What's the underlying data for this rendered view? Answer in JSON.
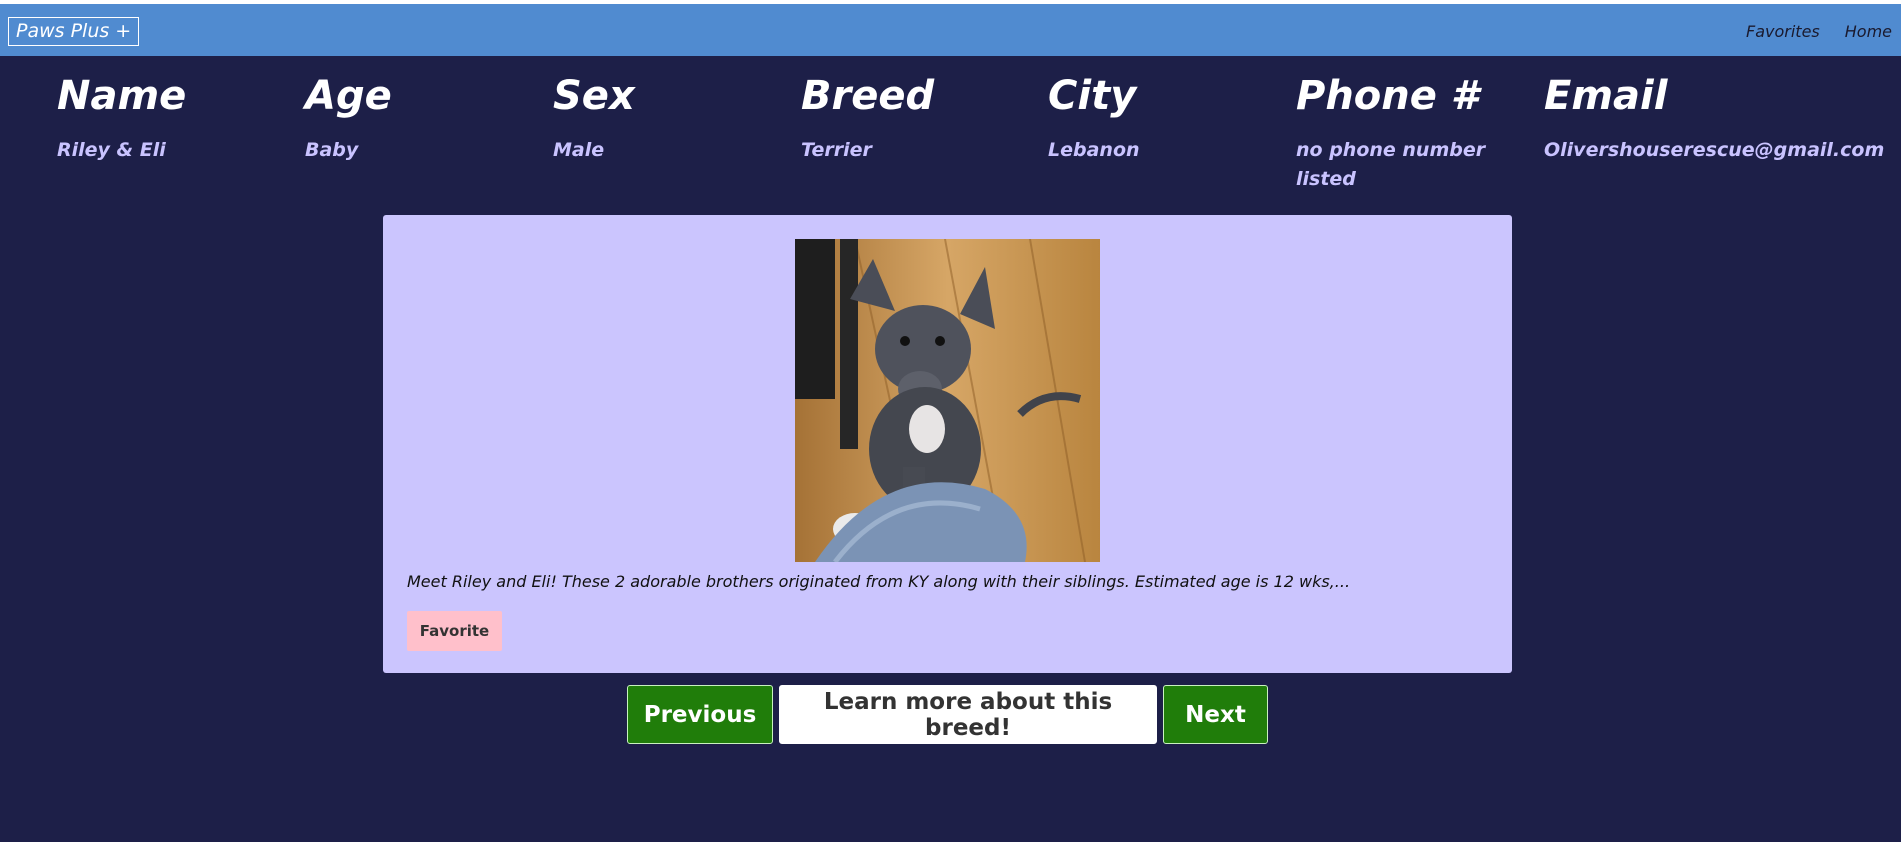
{
  "navbar": {
    "brand": "Paws Plus +",
    "links": [
      "Favorites",
      "Home"
    ]
  },
  "info": {
    "columns": [
      {
        "heading": "Name",
        "value": "Riley & Eli"
      },
      {
        "heading": "Age",
        "value": "Baby"
      },
      {
        "heading": "Sex",
        "value": "Male"
      },
      {
        "heading": "Breed",
        "value": "Terrier"
      },
      {
        "heading": "City",
        "value": "Lebanon"
      },
      {
        "heading": "Phone #",
        "value": "no phone number listed"
      },
      {
        "heading": "Email",
        "value": "Olivershouserescue@gmail.com"
      }
    ]
  },
  "card": {
    "photo_alt": "dog-photo",
    "description": "Meet Riley and Eli! These 2 adorable brothers originated from KY along with their siblings. Estimated age is 12 wks,...",
    "favorite_label": "Favorite"
  },
  "nav_buttons": {
    "previous": "Previous",
    "learn_more": "Learn more about this breed!",
    "next": "Next"
  },
  "colors": {
    "background": "#1d1f48",
    "navbar": "#508bd0",
    "card": "#cbc5fe",
    "value_text": "#c9c3ff",
    "button_green": "#207d0a",
    "favorite_pink": "#ffc0cb"
  }
}
